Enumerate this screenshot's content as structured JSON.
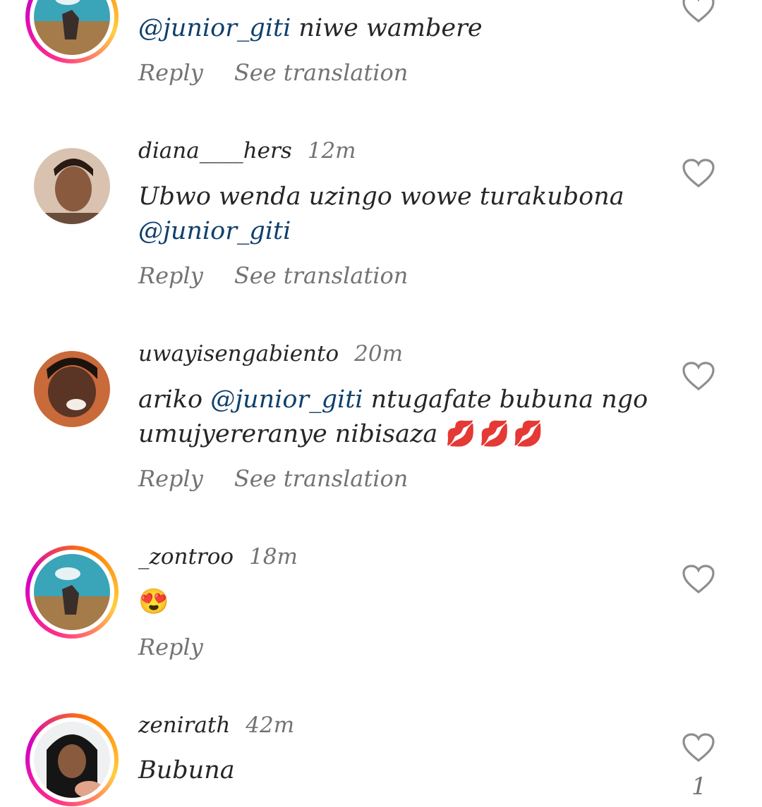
{
  "comments": [
    {
      "username": "",
      "time": "",
      "text_parts": [
        {
          "t": "@junior_giti",
          "mention": true
        },
        {
          "t": " niwe wambere",
          "mention": false
        }
      ],
      "reply": "Reply",
      "translate": "See translation",
      "avatar": "landscape-person-avatar",
      "story_ring": true
    },
    {
      "username": "diana____hers",
      "time": "12m",
      "text_parts": [
        {
          "t": "Ubwo wenda uzingo wowe turakubona",
          "mention": false
        },
        {
          "t": "@junior_giti",
          "mention": true
        }
      ],
      "reply": "Reply",
      "translate": "See translation",
      "avatar": "woman-selfie-avatar",
      "story_ring": false
    },
    {
      "username": "uwayisengabiento",
      "time": "20m",
      "text_parts": [
        {
          "t": "ariko ",
          "mention": false
        },
        {
          "t": "@junior_giti",
          "mention": true
        },
        {
          "t": "  ntugafate bubuna ngo umujyereranye nibisaza ",
          "mention": false
        }
      ],
      "emoji": "💋💋💋",
      "reply": "Reply",
      "translate": "See translation",
      "avatar": "smiling-girl-avatar",
      "story_ring": false
    },
    {
      "username": "_zontroo",
      "time": "18m",
      "emoji": "😍",
      "reply": "Reply",
      "avatar": "landscape-person-avatar",
      "story_ring": true
    },
    {
      "username": "zenirath",
      "time": "42m",
      "text_parts": [
        {
          "t": "Bubuna",
          "mention": false
        }
      ],
      "like_count": "1",
      "avatar": "hijab-girl-avatar",
      "story_ring": true
    }
  ]
}
